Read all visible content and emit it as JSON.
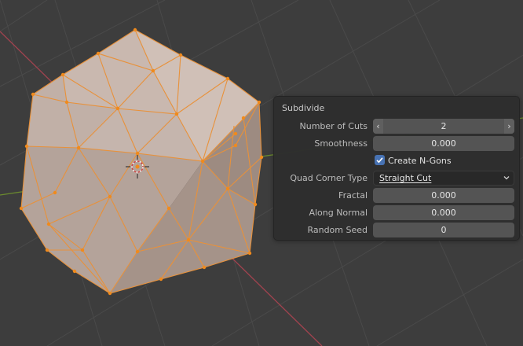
{
  "panel": {
    "title": "Subdivide",
    "number_of_cuts": {
      "label": "Number of Cuts",
      "value": "2",
      "left_arrow": "‹",
      "right_arrow": "›"
    },
    "smoothness": {
      "label": "Smoothness",
      "value": "0.000"
    },
    "create_ngons": {
      "label": "Create N-Gons",
      "checked": true
    },
    "quad_corner_type": {
      "label": "Quad Corner Type",
      "value": "Straight Cut"
    },
    "fractal": {
      "label": "Fractal",
      "value": "0.000"
    },
    "along_normal": {
      "label": "Along Normal",
      "value": "0.000"
    },
    "random_seed": {
      "label": "Random Seed",
      "value": "0"
    }
  },
  "viewport": {
    "background": "#3d3d3d",
    "grid_color": "#4a4a4a",
    "x_axis_color": "#a1434f",
    "y_axis_color": "#6b8b2e",
    "mesh_face_color": "#b8a8a0",
    "mesh_edge_color": "#e8913a",
    "vertex_color": "#f08a1c"
  },
  "icons": {
    "check": "checkmark-icon",
    "chevron": "chevron-down-icon",
    "origin": "object-origin-icon"
  }
}
